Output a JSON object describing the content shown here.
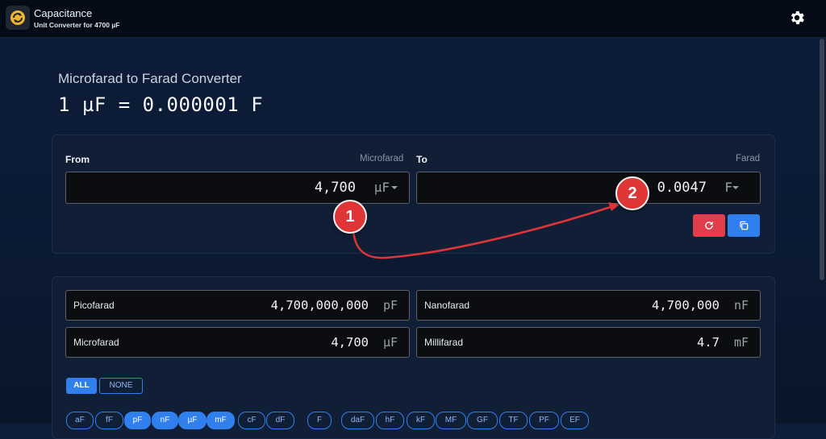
{
  "header": {
    "title": "Capacitance",
    "subtitle": "Unit Converter for 4700 µF"
  },
  "page": {
    "heading": "Microfarad to Farad Converter",
    "formula": "1 µF = 0.000001 F"
  },
  "converter": {
    "from": {
      "label": "From",
      "unit_name": "Microfarad",
      "value": "4,700",
      "unit": "µF"
    },
    "to": {
      "label": "To",
      "unit_name": "Farad",
      "value": "0.0047",
      "unit": "F"
    }
  },
  "results": [
    {
      "label": "Picofarad",
      "value": "4,700,000,000",
      "unit": "pF"
    },
    {
      "label": "Nanofarad",
      "value": "4,700,000",
      "unit": "nF"
    },
    {
      "label": "Microfarad",
      "value": "4,700",
      "unit": "µF"
    },
    {
      "label": "Millifarad",
      "value": "4.7",
      "unit": "mF"
    }
  ],
  "filters": {
    "all_label": "ALL",
    "none_label": "NONE",
    "units": [
      {
        "label": "aF",
        "selected": false
      },
      {
        "label": "fF",
        "selected": false
      },
      {
        "label": "pF",
        "selected": true
      },
      {
        "label": "nF",
        "selected": true
      },
      {
        "label": "µF",
        "selected": true
      },
      {
        "label": "mF",
        "selected": true
      },
      {
        "label": "cF",
        "selected": false
      },
      {
        "label": "dF",
        "selected": false
      },
      {
        "label": "F",
        "selected": false
      },
      {
        "label": "daF",
        "selected": false
      },
      {
        "label": "hF",
        "selected": false
      },
      {
        "label": "kF",
        "selected": false
      },
      {
        "label": "MF",
        "selected": false
      },
      {
        "label": "GF",
        "selected": false
      },
      {
        "label": "TF",
        "selected": false
      },
      {
        "label": "PF",
        "selected": false
      },
      {
        "label": "EF",
        "selected": false
      }
    ]
  },
  "annotations": {
    "one": "1",
    "two": "2"
  },
  "colors": {
    "accent": "#2f80ed",
    "reset": "#e23d4d",
    "annotation": "#e03537"
  },
  "icons": {
    "logo": "refresh-logo-icon",
    "settings": "gear-icon",
    "reset": "reset-icon",
    "copy": "copy-icon"
  }
}
